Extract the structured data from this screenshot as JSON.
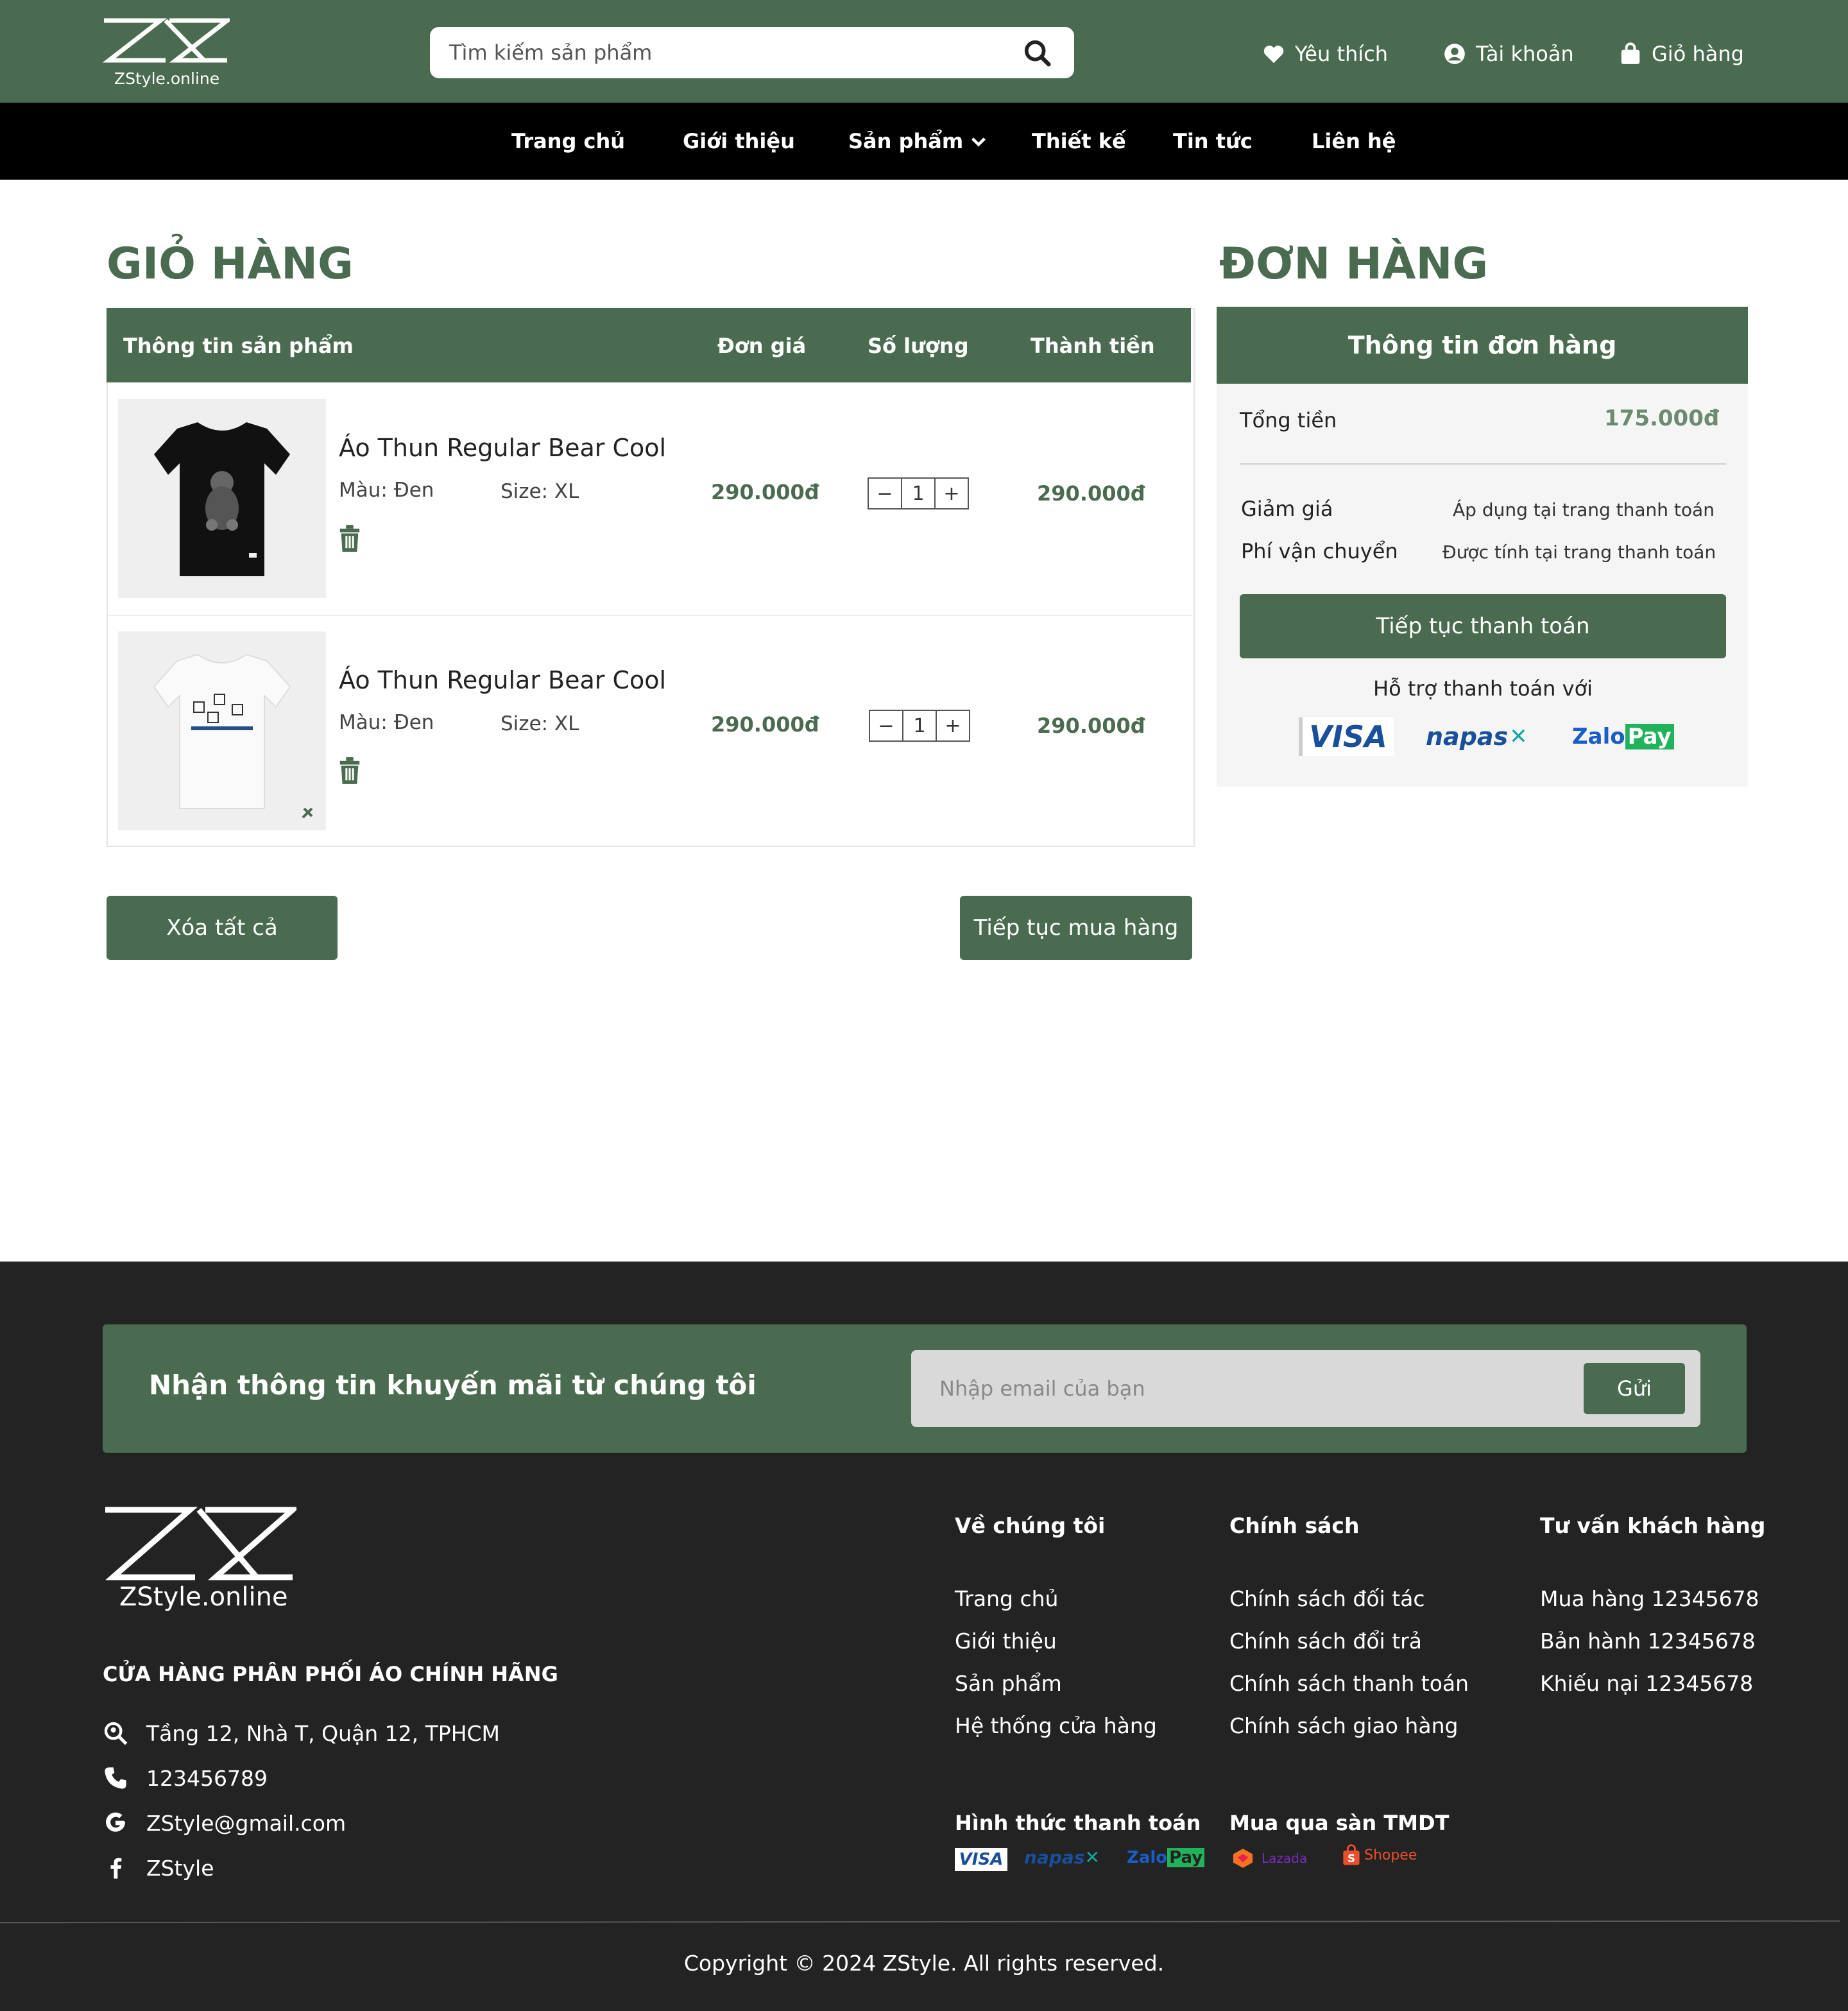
{
  "header": {
    "logo_text": "ZStyle.online",
    "search_placeholder": "Tìm kiếm sản phẩm",
    "favorites": "Yêu thích",
    "account": "Tài khoản",
    "cart": "Giỏ hàng"
  },
  "nav": {
    "home": "Trang chủ",
    "about": "Giới thiệu",
    "products": "Sản phẩm",
    "design": "Thiết kế",
    "news": "Tin tức",
    "contact": "Liên hệ"
  },
  "cart": {
    "title": "GIỎ HÀNG",
    "headers": {
      "info": "Thông tin sản phẩm",
      "price": "Đơn giá",
      "qty": "Số lượng",
      "total": "Thành tiền"
    },
    "items": [
      {
        "name": "Áo Thun Regular Bear Cool",
        "color": "Màu: Đen",
        "size": "Size: XL",
        "price": "290.000đ",
        "qty": "1",
        "total": "290.000đ"
      },
      {
        "name": "Áo Thun Regular Bear Cool",
        "color": "Màu: Đen",
        "size": "Size: XL",
        "price": "290.000đ",
        "qty": "1",
        "total": "290.000đ"
      }
    ],
    "clear_all": "Xóa tất cả",
    "continue_shopping": "Tiếp tục mua hàng"
  },
  "order": {
    "title": "ĐƠN HÀNG",
    "header": "Thông tin đơn hàng",
    "total_label": "Tổng tiền",
    "total_value": "175.000đ",
    "discount_label": "Giảm giá",
    "discount_value": "Áp dụng tại trang thanh toán",
    "shipping_label": "Phí vận chuyển",
    "shipping_value": "Được tính tại trang thanh toán",
    "checkout": "Tiếp tục thanh toán",
    "support": "Hỗ trợ thanh toán với",
    "pay_visa": "VISA",
    "pay_napas": "napas",
    "pay_zalo_a": "Zalo",
    "pay_zalo_b": "Pay"
  },
  "footer": {
    "newsletter_text": "Nhận thông tin khuyến mãi từ chúng tôi",
    "email_placeholder": "Nhập email của bạn",
    "send": "Gửi",
    "logo_text": "ZStyle.online",
    "tagline": "CỬA HÀNG PHÂN PHỐI ÁO CHÍNH HÃNG",
    "address": "Tầng 12, Nhà T, Quận 12, TPHCM",
    "phone": "123456789",
    "email": "ZStyle@gmail.com",
    "facebook": "ZStyle",
    "col1_title": "Về chúng tôi",
    "col1_links": [
      "Trang chủ",
      "Giới thiệu",
      "Sản phẩm",
      "Hệ thống cửa hàng"
    ],
    "col2_title": "Chính sách",
    "col2_links": [
      "Chính sách đối tác",
      "Chính sách đổi trả",
      "Chính sách thanh toán",
      "Chính sách giao hàng"
    ],
    "col3_title": "Tư vấn khách hàng",
    "col3_links": [
      "Mua hàng 12345678",
      "Bản hành 12345678",
      "Khiếu nại 12345678"
    ],
    "payment_title": "Hình thức thanh toán",
    "marketplace_title": "Mua qua sàn TMDT",
    "lazada": "Lazada",
    "shopee": "Shopee",
    "copyright": "Copyright © 2024 ZStyle. All rights reserved."
  },
  "colors": {
    "brand_green": "#4a6b50",
    "nav_black": "#000000",
    "footer_dark": "#232323"
  },
  "icons": [
    "search-icon",
    "heart-icon",
    "user-circle-icon",
    "shopping-bag-icon",
    "chevron-down-icon",
    "trash-icon",
    "map-search-icon",
    "phone-icon",
    "google-icon",
    "facebook-icon"
  ]
}
